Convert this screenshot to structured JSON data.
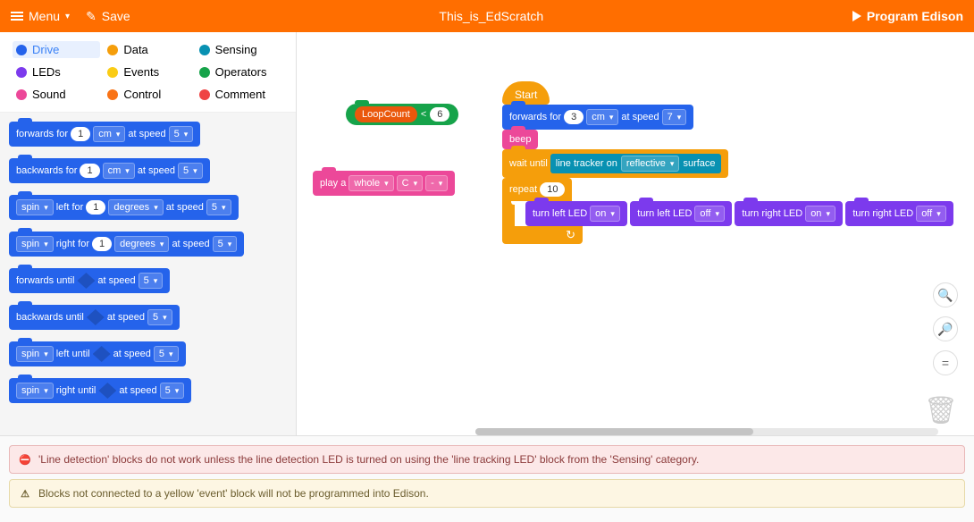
{
  "header": {
    "menu": "Menu",
    "save": "Save",
    "title": "This_is_EdScratch",
    "program": "Program Edison"
  },
  "categories": [
    {
      "name": "Drive",
      "color": "#2563eb"
    },
    {
      "name": "Data",
      "color": "#f59e0b"
    },
    {
      "name": "Sensing",
      "color": "#0891b2"
    },
    {
      "name": "LEDs",
      "color": "#7c3aed"
    },
    {
      "name": "Events",
      "color": "#facc15"
    },
    {
      "name": "Operators",
      "color": "#16a34a"
    },
    {
      "name": "Sound",
      "color": "#ec4899"
    },
    {
      "name": "Control",
      "color": "#f97316"
    },
    {
      "name": "Comment",
      "color": "#ef4444"
    }
  ],
  "palette": {
    "fwd": "forwards for",
    "bwd": "backwards for",
    "spin": "spin",
    "left_for": "left for",
    "right_for": "right for",
    "fwd_until": "forwards until",
    "bwd_until": "backwards until",
    "left_until": "left until",
    "right_until": "right until",
    "at_speed": "at speed",
    "cm": "cm",
    "deg": "degrees",
    "val1": "1",
    "val5": "5"
  },
  "loose": {
    "loopcount": "LoopCount",
    "lt": "<",
    "six": "6",
    "playa": "play a",
    "whole": "whole",
    "note": "C",
    "mod": "-"
  },
  "script": {
    "start": "Start",
    "forwards_for": "forwards for",
    "cm": "cm",
    "at_speed": "at speed",
    "f_val": "3",
    "f_spd": "7",
    "beep": "beep",
    "wait_until": "wait until",
    "line_tracker_on": "line tracker on",
    "reflective": "reflective",
    "surface": "surface",
    "repeat": "repeat",
    "rep_val": "10",
    "turn_left_led": "turn left LED",
    "turn_right_led": "turn right LED",
    "on": "on",
    "off": "off"
  },
  "warnings": {
    "err": "'Line detection' blocks do not work unless the line detection LED is turned on using the 'line tracking LED' block from the 'Sensing' category.",
    "warn": "Blocks not connected to a yellow 'event' block will not be programmed into Edison."
  }
}
